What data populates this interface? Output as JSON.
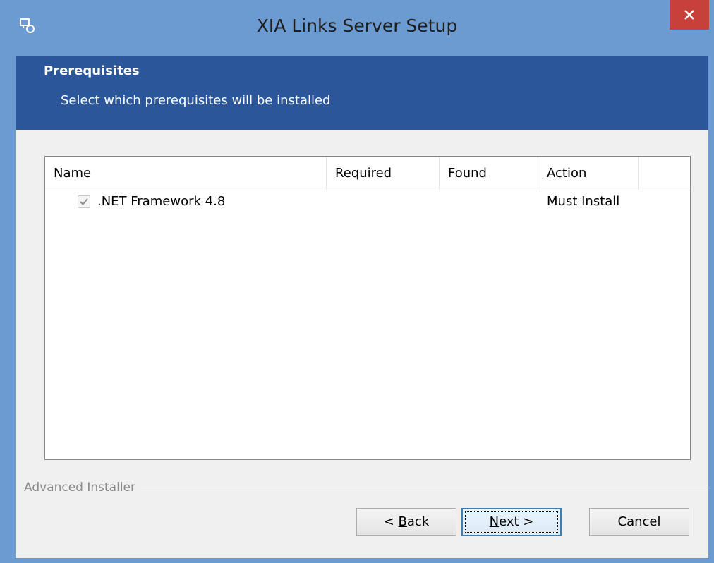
{
  "window": {
    "title": "XIA Links Server Setup",
    "icons": {
      "app": "setup-app-icon",
      "close": "close-icon"
    }
  },
  "banner": {
    "title": "Prerequisites",
    "subtitle": "Select which prerequisites will be installed"
  },
  "table": {
    "columns": [
      "Name",
      "Required",
      "Found",
      "Action"
    ],
    "rows": [
      {
        "checked": true,
        "name": ".NET Framework 4.8",
        "required": "",
        "found": "",
        "action": "Must Install"
      }
    ]
  },
  "branding": "Advanced Installer",
  "buttons": {
    "back_prefix": "< ",
    "back_key": "B",
    "back_rest": "ack",
    "next_key": "N",
    "next_rest": "ext >",
    "cancel": "Cancel"
  },
  "colors": {
    "titlebar": "#6b9bd0",
    "banner": "#2b579a",
    "close": "#c7403a"
  }
}
